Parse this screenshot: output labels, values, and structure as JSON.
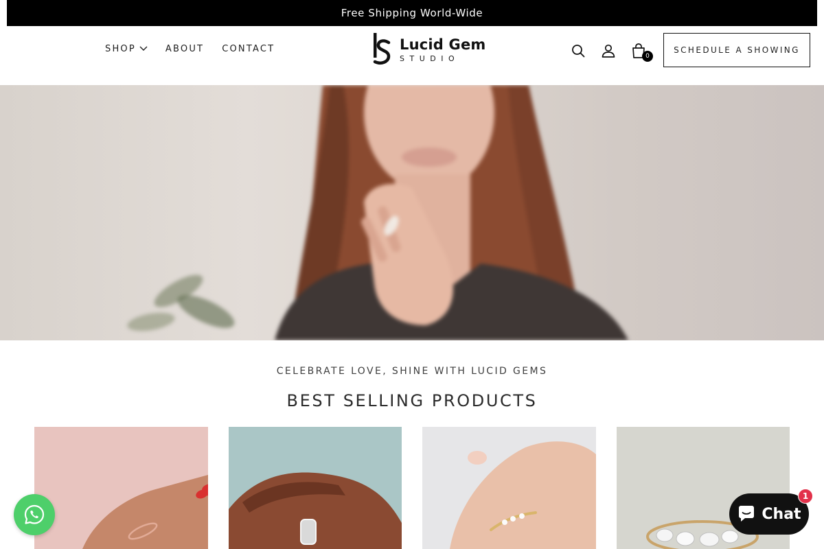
{
  "announcement": {
    "text": "Free Shipping World-Wide"
  },
  "nav": {
    "shop": "SHOP",
    "about": "ABOUT",
    "contact": "CONTACT"
  },
  "logo": {
    "title": "Lucid Gem",
    "subtitle": "STUDIO"
  },
  "header_icons": [
    "search-icon",
    "account-icon",
    "cart-icon"
  ],
  "cart": {
    "count": "0"
  },
  "schedule_button": "SCHEDULE A SHOWING",
  "hero": {
    "image": "woman-wearing-ring-blurred"
  },
  "section": {
    "eyebrow": "CELEBRATE LOVE, SHINE WITH LUCID GEMS",
    "title": "BEST SELLING PRODUCTS"
  },
  "products": [
    {
      "image": "hand-with-thin-rose-gold-band-pink-background"
    },
    {
      "image": "hand-with-eternity-band-mint-background"
    },
    {
      "image": "hand-with-marquise-band-grey-background"
    },
    {
      "image": "gold-ring-with-diamonds-product-shot"
    }
  ],
  "whatsapp": {
    "icon": "whatsapp-icon",
    "color": "#4ecf6a"
  },
  "chat": {
    "label": "Chat",
    "badge": "1"
  },
  "colors": {
    "announcement_bg": "#000000",
    "chat_bg": "#111111",
    "badge": "#e2314a"
  }
}
